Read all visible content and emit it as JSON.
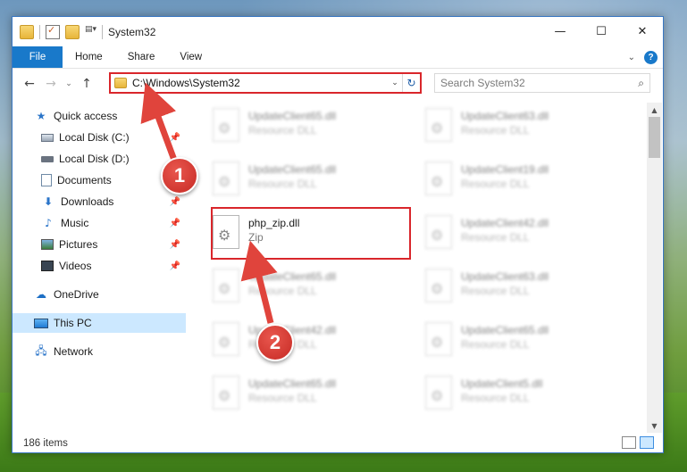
{
  "window": {
    "title": "System32",
    "controls": {
      "minimize": "—",
      "maximize": "☐",
      "close": "✕"
    }
  },
  "ribbon": {
    "tabs": [
      {
        "label": "File",
        "active": true
      },
      {
        "label": "Home"
      },
      {
        "label": "Share"
      },
      {
        "label": "View"
      }
    ]
  },
  "address_bar": {
    "path": "C:\\Windows\\System32",
    "icon": "folder-icon"
  },
  "search": {
    "placeholder": "Search System32"
  },
  "nav_pane": {
    "items": [
      {
        "label": "Quick access",
        "icon": "star-icon",
        "pinned": false
      },
      {
        "label": "Local Disk (C:)",
        "icon": "drive-icon",
        "pinned": true
      },
      {
        "label": "Local Disk (D:)",
        "icon": "drive-icon",
        "pinned": false
      },
      {
        "label": "Documents",
        "icon": "documents-icon",
        "pinned": true
      },
      {
        "label": "Downloads",
        "icon": "download-icon",
        "pinned": true
      },
      {
        "label": "Music",
        "icon": "music-icon",
        "pinned": true
      },
      {
        "label": "Pictures",
        "icon": "pictures-icon",
        "pinned": true
      },
      {
        "label": "Videos",
        "icon": "videos-icon",
        "pinned": true
      },
      {
        "label": "OneDrive",
        "icon": "onedrive-icon",
        "pinned": false
      },
      {
        "label": "This PC",
        "icon": "computer-icon",
        "selected": true
      },
      {
        "label": "Network",
        "icon": "network-icon",
        "pinned": false
      }
    ]
  },
  "files": {
    "left": [
      {
        "name": "UpdateClient65.dll",
        "type": "Resource DLL"
      },
      {
        "name": "UpdateClient65.dll",
        "type": "Resource DLL"
      },
      {
        "name": "php_zip.dll",
        "type": "Zip",
        "highlighted": true
      },
      {
        "name": "UpdateClient65.dll",
        "type": "Resource DLL"
      },
      {
        "name": "UpdateClient42.dll",
        "type": "Resource DLL"
      },
      {
        "name": "UpdateClient65.dll",
        "type": "Resource DLL"
      }
    ],
    "right": [
      {
        "name": "UpdateClient63.dll",
        "type": "Resource DLL"
      },
      {
        "name": "UpdateClient19.dll",
        "type": "Resource DLL"
      },
      {
        "name": "UpdateClient42.dll",
        "type": "Resource DLL"
      },
      {
        "name": "UpdateClient63.dll",
        "type": "Resource DLL"
      },
      {
        "name": "UpdateClient65.dll",
        "type": "Resource DLL"
      },
      {
        "name": "UpdateClient5.dll",
        "type": "Resource DLL"
      }
    ]
  },
  "status": {
    "item_count": "186 items"
  },
  "annotations": {
    "step1": "1",
    "step2": "2"
  },
  "colors": {
    "accent": "#1979ca",
    "highlight": "#d9262b",
    "selected": "#cce8ff"
  }
}
